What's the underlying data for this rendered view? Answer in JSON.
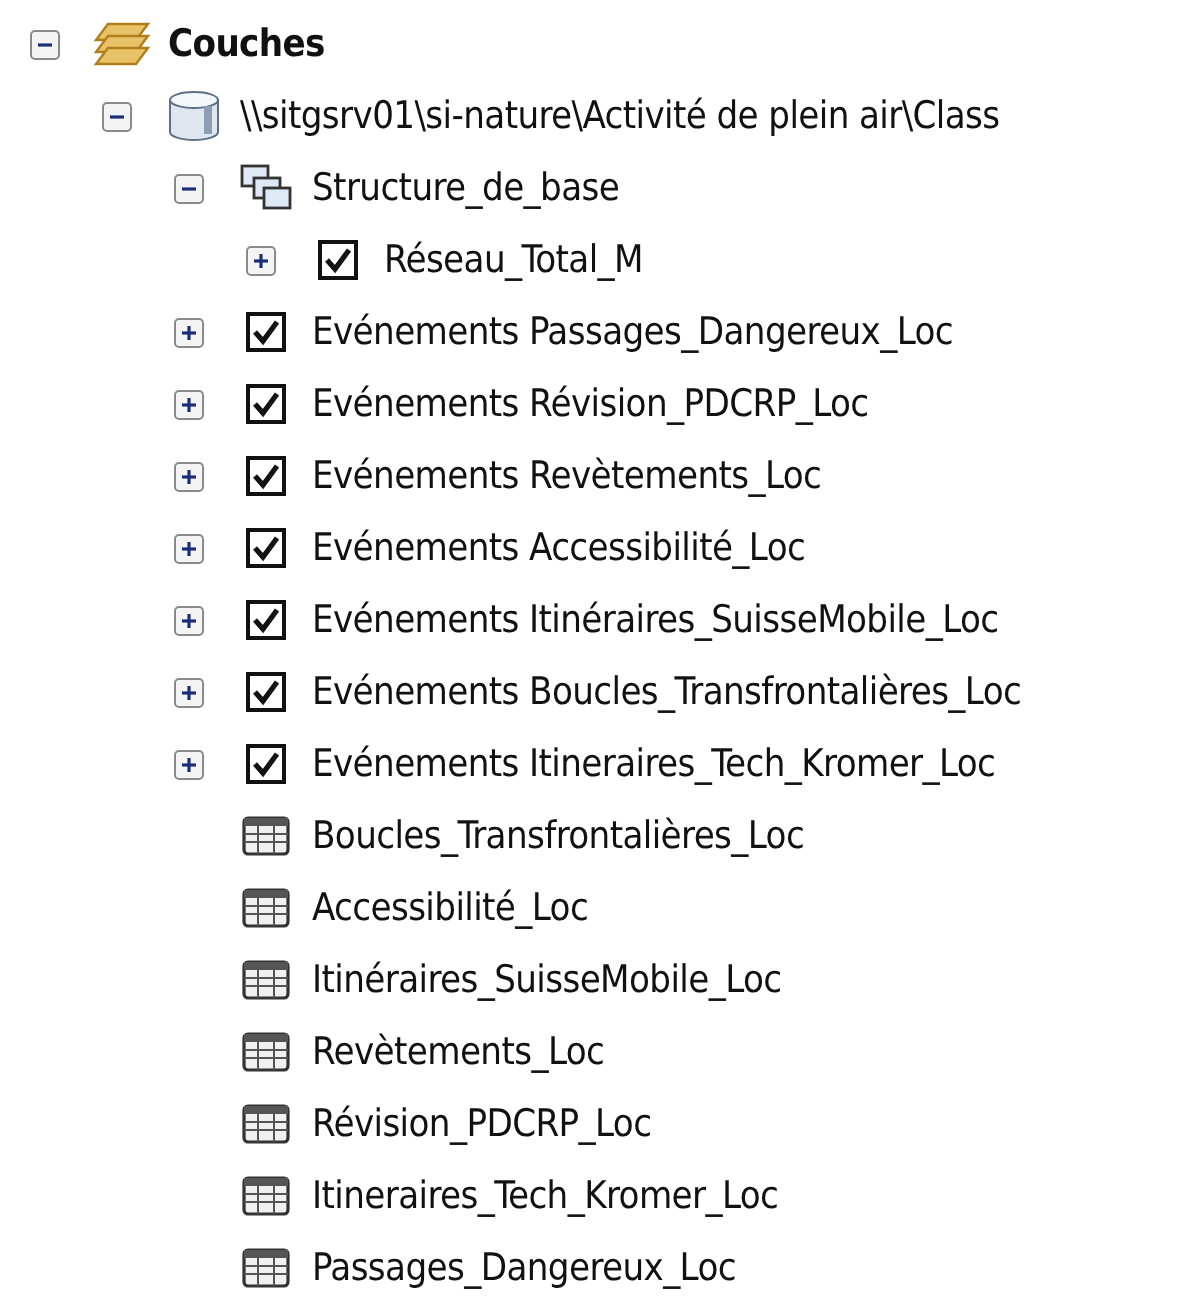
{
  "tree": [
    {
      "kind": "group",
      "label": "Couches",
      "expanded": true,
      "children": [
        {
          "kind": "database",
          "label": "\\\\sitgsrv01\\si-nature\\Activité de plein air\\Class",
          "expanded": true,
          "children": [
            {
              "kind": "group-layer",
              "label": "Structure_de_base",
              "expanded": true,
              "children": [
                {
                  "kind": "layer",
                  "label": "Réseau_Total_M",
                  "expanded": false,
                  "checked": true
                }
              ]
            },
            {
              "kind": "layer",
              "label": "Evénements Passages_Dangereux_Loc",
              "expanded": false,
              "checked": true
            },
            {
              "kind": "layer",
              "label": "Evénements Révision_PDCRP_Loc",
              "expanded": false,
              "checked": true
            },
            {
              "kind": "layer",
              "label": "Evénements Revètements_Loc",
              "expanded": false,
              "checked": true
            },
            {
              "kind": "layer",
              "label": "Evénements Accessibilité_Loc",
              "expanded": false,
              "checked": true
            },
            {
              "kind": "layer",
              "label": "Evénements Itinéraires_SuisseMobile_Loc",
              "expanded": false,
              "checked": true
            },
            {
              "kind": "layer",
              "label": "Evénements Boucles_Transfrontalières_Loc",
              "expanded": false,
              "checked": true
            },
            {
              "kind": "layer",
              "label": "Evénements Itineraires_Tech_Kromer_Loc",
              "expanded": false,
              "checked": true
            },
            {
              "kind": "table",
              "label": "Boucles_Transfrontalières_Loc"
            },
            {
              "kind": "table",
              "label": "Accessibilité_Loc"
            },
            {
              "kind": "table",
              "label": "Itinéraires_SuisseMobile_Loc"
            },
            {
              "kind": "table",
              "label": "Revètements_Loc"
            },
            {
              "kind": "table",
              "label": "Révision_PDCRP_Loc"
            },
            {
              "kind": "table",
              "label": "Itineraires_Tech_Kromer_Loc"
            },
            {
              "kind": "table",
              "label": "Passages_Dangereux_Loc"
            }
          ]
        }
      ]
    }
  ]
}
